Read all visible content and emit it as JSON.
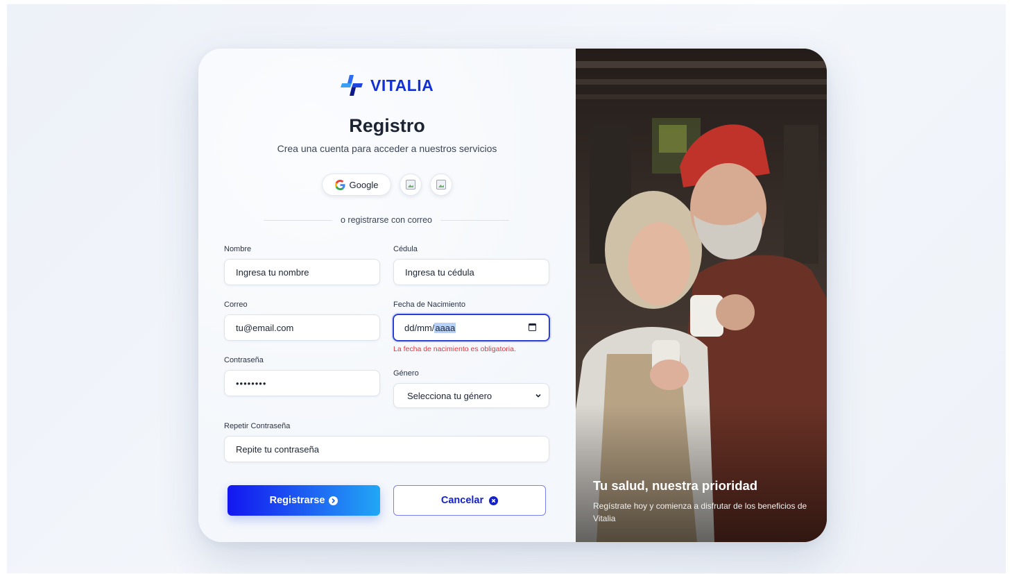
{
  "brand": {
    "name": "VITALIA",
    "accent": "#1230d6"
  },
  "header": {
    "title": "Registro",
    "subtitle": "Crea una cuenta para acceder a nuestros servicios"
  },
  "social": {
    "google_label": "Google",
    "extra_buttons": [
      "broken-image-icon",
      "broken-image-icon"
    ]
  },
  "divider_text": "o registrarse con correo",
  "form": {
    "nombre": {
      "label": "Nombre",
      "value": "Ingresa tu nombre"
    },
    "cedula": {
      "label": "Cédula",
      "value": "Ingresa tu cédula"
    },
    "correo": {
      "label": "Correo",
      "value": "tu@email.com"
    },
    "fecha": {
      "label": "Fecha de Nacimiento",
      "value_prefix": "dd/mm/",
      "value_selected": "aaaa",
      "error": "La fecha de nacimiento es obligatoria."
    },
    "contrasena": {
      "label": "Contraseña",
      "value": "••••••••"
    },
    "genero": {
      "label": "Género",
      "selected": "Selecciona tu género"
    },
    "repetir": {
      "label": "Repetir Contraseña",
      "value": "Repite tu contraseña"
    }
  },
  "actions": {
    "primary": "Registrarse",
    "secondary": "Cancelar"
  },
  "hero": {
    "title": "Tu salud, nuestra prioridad",
    "text": "Regístrate hoy y comienza a disfrutar de los beneficios de Vitalia"
  },
  "colors": {
    "error": "#e5333d",
    "primary_gradient_start": "#1316f0",
    "primary_gradient_end": "#21a7f5"
  }
}
